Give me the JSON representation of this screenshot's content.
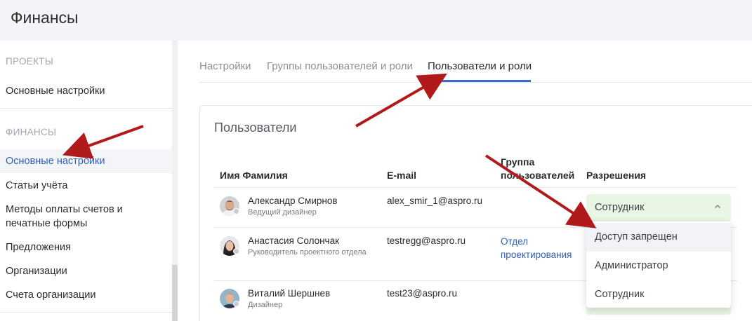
{
  "header": {
    "title": "Финансы"
  },
  "sidebar": {
    "sections": [
      {
        "label": "ПРОЕКТЫ",
        "items": [
          {
            "label": "Основные настройки"
          }
        ]
      },
      {
        "label": "ФИНАНСЫ",
        "items": [
          {
            "label": "Основные настройки",
            "active": true
          },
          {
            "label": "Статьи учёта"
          },
          {
            "label": "Методы оплаты счетов и печатные формы"
          },
          {
            "label": "Предложения"
          },
          {
            "label": "Организации"
          },
          {
            "label": "Счета организации"
          }
        ]
      }
    ]
  },
  "tabs": [
    {
      "label": "Настройки"
    },
    {
      "label": "Группы пользователей и роли"
    },
    {
      "label": "Пользователи и роли",
      "active": true
    }
  ],
  "card": {
    "title": "Пользователи",
    "columns": {
      "name": "Имя Фамилия",
      "email": "E-mail",
      "group": "Группа пользователей",
      "permissions": "Разрешения"
    },
    "rows": [
      {
        "name": "Александр Смирнов",
        "role": "Ведущий дизайнер",
        "email": "alex_smir_1@aspro.ru",
        "group": "",
        "permission": "Сотрудник"
      },
      {
        "name": "Анастасия Солончак",
        "role": "Руководитель проектного отдела",
        "email": "testregg@aspro.ru",
        "group": "Отдел проектирования",
        "permission": ""
      },
      {
        "name": "Виталий Шершнев",
        "role": "Дизайнер",
        "email": "test23@aspro.ru",
        "group": "",
        "permission": ""
      }
    ]
  },
  "dropdown": {
    "options": [
      {
        "label": "Доступ запрещен",
        "highlighted": true
      },
      {
        "label": "Администратор"
      },
      {
        "label": "Сотрудник"
      }
    ]
  },
  "colors": {
    "accent": "#2f5fb3",
    "tab_underline": "#3a6cc7",
    "select_bg": "#e9f6e3",
    "annotation_arrow": "#b11a1a"
  },
  "icons": {
    "select_chevron": "chevron-up-icon",
    "status": "status-dot-icon"
  }
}
